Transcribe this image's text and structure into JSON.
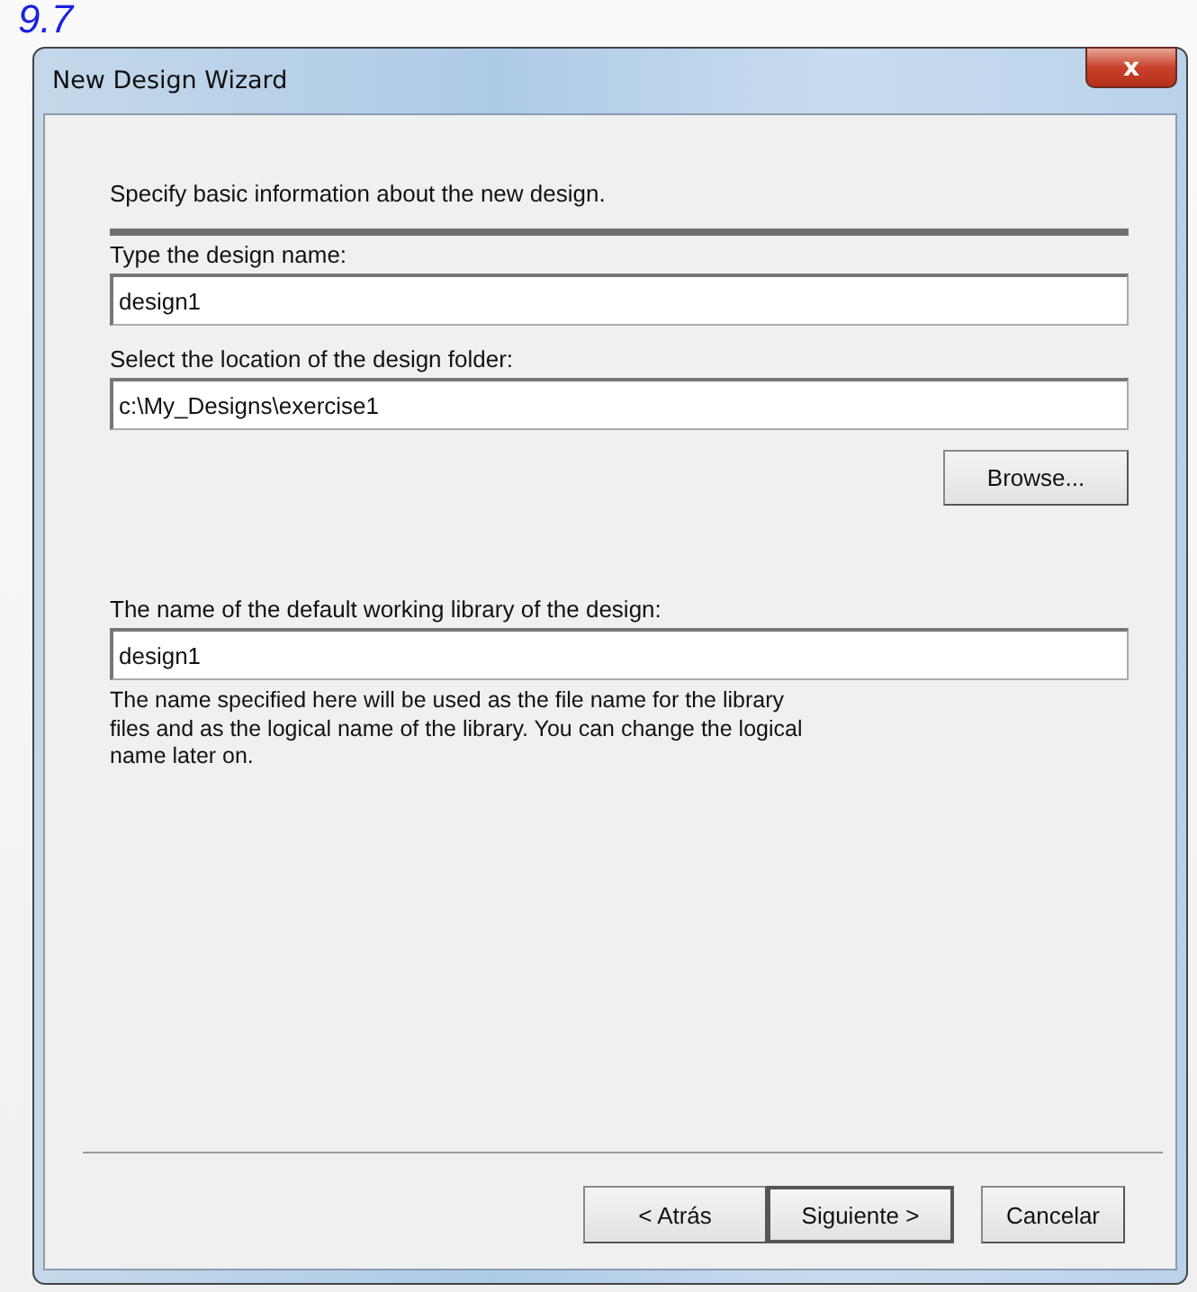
{
  "background": {
    "version_text": "9.7"
  },
  "window": {
    "title": "New Design Wizard",
    "close_label": "x"
  },
  "intro": "Specify basic information about the new design.",
  "fields": [
    {
      "label": "Type the design name:",
      "value": "design1"
    },
    {
      "label": "Select the location of the design folder:",
      "value": "c:\\My_Designs\\exercise1"
    }
  ],
  "browse_button": "Browse...",
  "library": {
    "label": "The name of the default working library of the design:",
    "value": "design1",
    "help": "The name specified here will be used as the file name for the library files and as the logical name of the library. You can change the logical name later on."
  },
  "buttons": [
    {
      "label": "< Atrás",
      "default": false
    },
    {
      "label": "Siguiente >",
      "default": true
    },
    {
      "label": "Cancelar",
      "default": false
    }
  ]
}
